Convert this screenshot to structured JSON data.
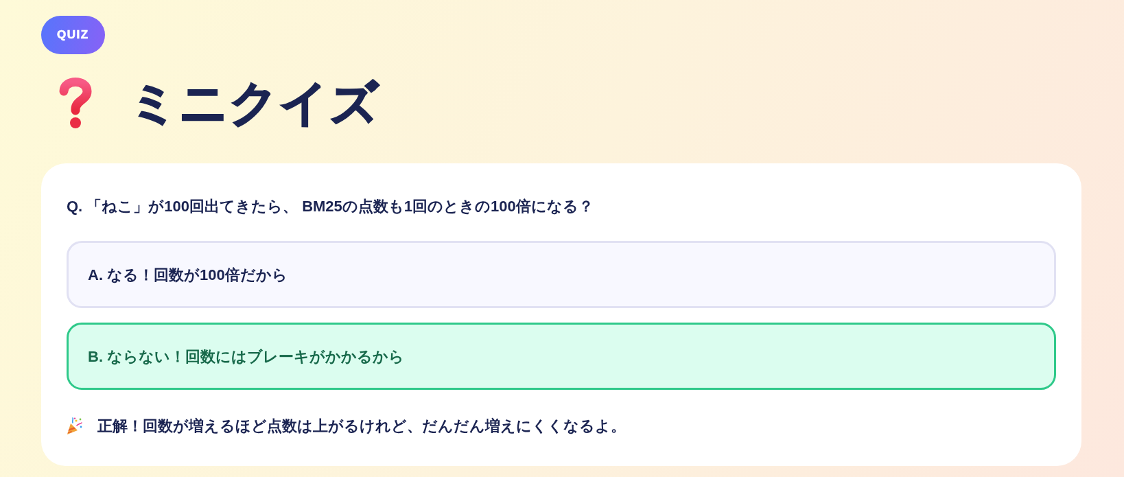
{
  "badge": {
    "label": "QUIZ"
  },
  "title": {
    "text": "ミニクイズ"
  },
  "question": {
    "text": "Q. 「ねこ」が100回出てきたら、 BM25の点数も1回のときの100倍になる？"
  },
  "options": [
    {
      "label": "A. なる！回数が100倍だから",
      "selected": false
    },
    {
      "label": "B. ならない！回数にはブレーキがかかるから",
      "selected": true
    }
  ],
  "feedback": {
    "text": "正解！回数が増えるほど点数は上がるけれど、だんだん増えにくくなるよ。"
  }
}
